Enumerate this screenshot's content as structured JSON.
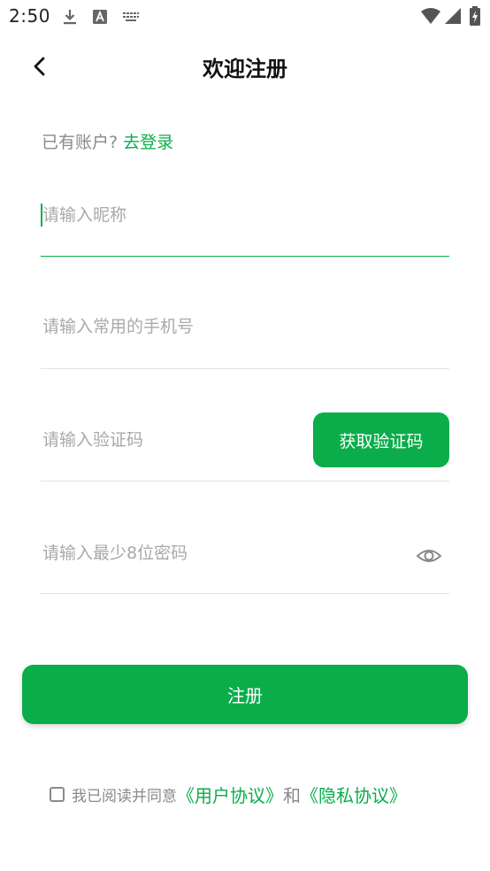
{
  "status_bar": {
    "time": "2:50"
  },
  "header": {
    "title": "欢迎注册"
  },
  "login_prompt": {
    "text": "已有账户?",
    "link": "去登录"
  },
  "form": {
    "nickname_placeholder": "请输入昵称",
    "phone_placeholder": "请输入常用的手机号",
    "code_placeholder": "请输入验证码",
    "get_code_label": "获取验证码",
    "password_placeholder": "请输入最少8位密码"
  },
  "register_button": {
    "label": "注册"
  },
  "agreement": {
    "prefix": "我已阅读并同意",
    "user_agreement": "《用户协议》",
    "and": "和",
    "privacy_policy": "《隐私协议》"
  },
  "colors": {
    "accent": "#0aad4a",
    "placeholder": "#a9a9a9",
    "divider": "#e3e3e3"
  }
}
